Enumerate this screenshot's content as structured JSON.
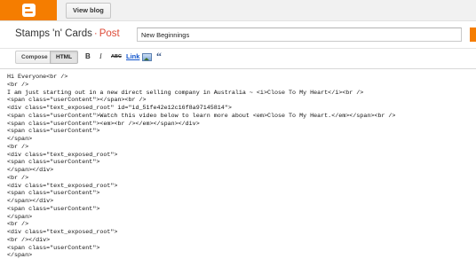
{
  "header": {
    "logo_icon": "blogger-logo-icon",
    "view_blog_label": "View blog",
    "brand_color": "#f57d00"
  },
  "titlebar": {
    "blog_name": "Stamps 'n' Cards",
    "separator": "·",
    "section": "Post",
    "post_title_value": "New Beginnings"
  },
  "editor_toolbar": {
    "compose_tab": "Compose",
    "html_tab": "HTML",
    "active_tab": "HTML",
    "bold_label": "B",
    "italic_label": "I",
    "strike_label": "ABC",
    "link_label": "Link",
    "image_icon": "insert-image-icon",
    "video_icon": "insert-video-icon",
    "quote_label": "“"
  },
  "editor": {
    "lines": [
      "Hi Everyone<br />",
      "<br />",
      "I am just starting out in a new direct selling company in Australia ~ <i>Close To My Heart</i><br />",
      "<span class=\"userContent\"></span><br />",
      "<div class=\"text_exposed_root\" id=\"id_51fe42e12c16f8a97145814\">",
      "<span class=\"userContent\">Watch this video below to learn more about <em>Close To My Heart.</em></span><br />",
      "<span class=\"userContent\"><em><br /></em></span></div>",
      "<span class=\"userContent\">",
      "</span>",
      "<br />",
      "<div class=\"text_exposed_root\">",
      "<span class=\"userContent\">",
      "</span></div>",
      "<br />",
      "<div class=\"text_exposed_root\">",
      "<span class=\"userContent\">",
      "</span></div>",
      "<span class=\"userContent\">",
      "</span>",
      "<br />",
      "<div class=\"text_exposed_root\">",
      "<br /></div>",
      "<span class=\"userContent\">",
      "</span>"
    ]
  }
}
